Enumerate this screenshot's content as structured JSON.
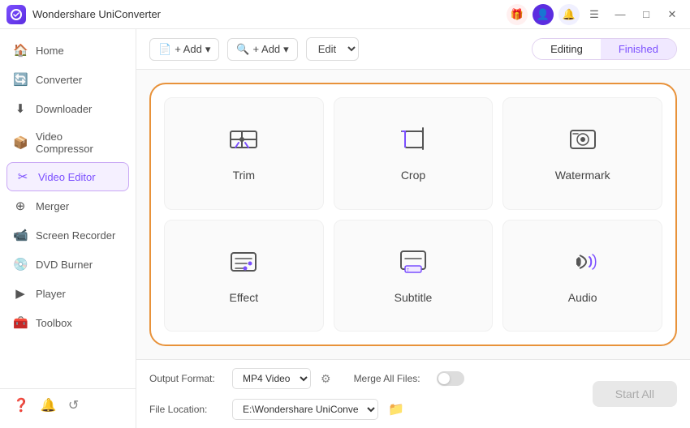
{
  "titleBar": {
    "appName": "Wondershare UniConverter",
    "logoText": "W",
    "controls": {
      "minimize": "—",
      "maximize": "□",
      "close": "✕"
    }
  },
  "sidebar": {
    "items": [
      {
        "id": "home",
        "label": "Home",
        "icon": "🏠"
      },
      {
        "id": "converter",
        "label": "Converter",
        "icon": "🔄"
      },
      {
        "id": "downloader",
        "label": "Downloader",
        "icon": "⬇"
      },
      {
        "id": "video-compressor",
        "label": "Video Compressor",
        "icon": "📦"
      },
      {
        "id": "video-editor",
        "label": "Video Editor",
        "icon": "✂",
        "active": true
      },
      {
        "id": "merger",
        "label": "Merger",
        "icon": "⊕"
      },
      {
        "id": "screen-recorder",
        "label": "Screen Recorder",
        "icon": "📹"
      },
      {
        "id": "dvd-burner",
        "label": "DVD Burner",
        "icon": "💿"
      },
      {
        "id": "player",
        "label": "Player",
        "icon": "▶"
      },
      {
        "id": "toolbox",
        "label": "Toolbox",
        "icon": "🧰"
      }
    ],
    "bottomIcons": [
      "?",
      "🔔",
      "↺"
    ]
  },
  "toolbar": {
    "addFileLabel": "+ Add",
    "addMediaLabel": "+ Add",
    "editOptions": [
      "Edit"
    ],
    "tabs": {
      "editing": "Editing",
      "finished": "Finished"
    }
  },
  "tools": [
    {
      "id": "trim",
      "label": "Trim",
      "icon": "trim"
    },
    {
      "id": "crop",
      "label": "Crop",
      "icon": "crop"
    },
    {
      "id": "watermark",
      "label": "Watermark",
      "icon": "watermark"
    },
    {
      "id": "effect",
      "label": "Effect",
      "icon": "effect"
    },
    {
      "id": "subtitle",
      "label": "Subtitle",
      "icon": "subtitle"
    },
    {
      "id": "audio",
      "label": "Audio",
      "icon": "audio"
    }
  ],
  "bottomBar": {
    "outputFormatLabel": "Output Format:",
    "outputFormatValue": "MP4 Video",
    "fileLocationLabel": "File Location:",
    "fileLocationValue": "E:\\Wondershare UniConverter",
    "mergeAllFilesLabel": "Merge All Files:",
    "startAllLabel": "Start All"
  }
}
